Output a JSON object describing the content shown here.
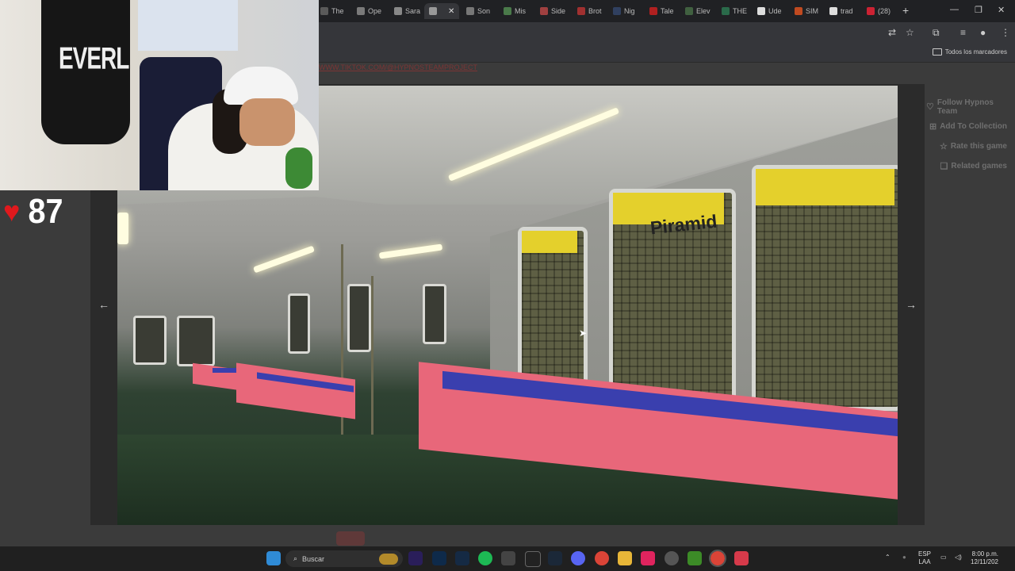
{
  "browser": {
    "tabs": [
      {
        "label": "The",
        "color": "#5a5a5a"
      },
      {
        "label": "Ope",
        "color": "#7a7a7a"
      },
      {
        "label": "Sara",
        "color": "#888888"
      },
      {
        "label": "",
        "color": "#999999",
        "active": true
      },
      {
        "label": "Son",
        "color": "#777777"
      },
      {
        "label": "Mis",
        "color": "#4a7a4a"
      },
      {
        "label": "Side",
        "color": "#a04040"
      },
      {
        "label": "Brot",
        "color": "#a03030"
      },
      {
        "label": "Nig",
        "color": "#304060"
      },
      {
        "label": "Tale",
        "color": "#b02020"
      },
      {
        "label": "Elev",
        "color": "#406040"
      },
      {
        "label": "THE",
        "color": "#2a6a4a"
      },
      {
        "label": "Ude",
        "color": "#dddddd"
      },
      {
        "label": "SIM",
        "color": "#c04a20"
      },
      {
        "label": "trad",
        "color": "#dddddd"
      },
      {
        "label": "(28)",
        "color": "#cc2233"
      }
    ],
    "bookmarks_all": "Todos los marcadores"
  },
  "page": {
    "ghost_link": "WWW.TIKTOK.COM/@HYPNOSTEAMPROJECT",
    "side_links": [
      {
        "icon": "♡",
        "label": "Follow Hypnos Team"
      },
      {
        "icon": "⊞",
        "label": "Add To Collection"
      },
      {
        "icon": "☆",
        "label": "Rate this game"
      },
      {
        "icon": "❑",
        "label": "Related games"
      }
    ]
  },
  "game": {
    "station_sign": "Piramid"
  },
  "overlay": {
    "bag_logo": "EVERL",
    "lives_count": "87"
  },
  "taskbar": {
    "search_placeholder": "Buscar",
    "language": "ESP",
    "region": "LAA",
    "time": "8:00 p.m.",
    "date": "12/11/202"
  }
}
